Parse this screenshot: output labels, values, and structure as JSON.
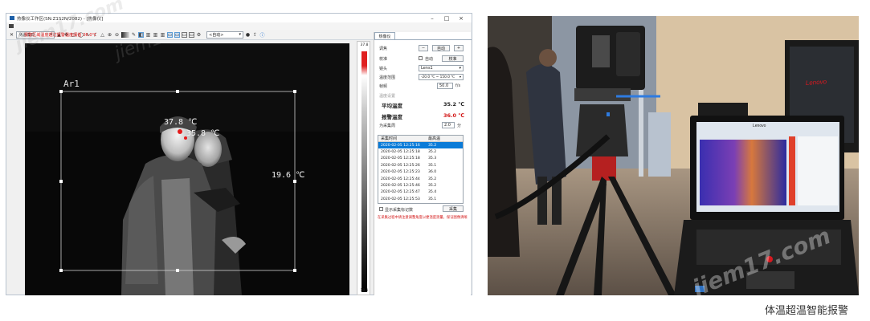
{
  "app": {
    "title": "热像仪工作区(SN:Z1S2N/2082) - [热像仪]",
    "window_buttons": [
      "–",
      "□",
      "×"
    ]
  },
  "toolbar": {
    "mode_select": "测温模式",
    "range_select": "<自动>"
  },
  "alarm_banner": "报警区域温度超过报警温度阈值 36.0℃",
  "thermal": {
    "area_label": "Ar1",
    "reading_1": "37.8 ℃",
    "reading_2": "35.8 ℃",
    "reading_3": "19.6 ℃"
  },
  "scale": {
    "top": "37.8",
    "bottom": "18.1"
  },
  "panel": {
    "tab": "热像仪",
    "focus_label": "调焦",
    "focus_minus": "−",
    "focus_auto": "自动",
    "focus_plus": "+",
    "calib_label": "校准",
    "calib_auto_checkbox": "自动",
    "calib_button": "校准",
    "lens_label": "镜头",
    "lens_value": "Lens1",
    "range_label": "温度范围",
    "range_value": "-20.0 ℃ ~ 150.0 ℃",
    "emis_label": "帧频",
    "emis_value": "50.0",
    "emis_unit": "f/s",
    "section_label": "温度设置",
    "avg_label": "平均温度",
    "avg_value": "35.2 ℃",
    "alarm_label": "报警温度",
    "alarm_value": "36.0 ℃",
    "interval_label": "为采集周",
    "interval_value": "2.0",
    "interval_unit": "分",
    "table_headers": [
      "采集时间",
      "最高温"
    ],
    "table_rows": [
      [
        "2020-02-05 12:25:16",
        "35.2"
      ],
      [
        "2020-02-05 12:25:18",
        "35.2"
      ],
      [
        "2020-02-05 12:25:18",
        "35.3"
      ],
      [
        "2020-02-05 12:25:26",
        "35.1"
      ],
      [
        "2020-02-05 12:25:23",
        "36.0"
      ],
      [
        "2020-02-05 12:25:44",
        "35.2"
      ],
      [
        "2020-02-05 12:25:46",
        "35.2"
      ],
      [
        "2020-02-05 12:25:47",
        "35.4"
      ],
      [
        "2020-02-05 12:25:53",
        "35.1"
      ]
    ],
    "show_record_checkbox": "显示采集标记数",
    "capture_button": "采集",
    "note": "在采集过程中请注意调整角度以便温度测量，保证图像清晰"
  },
  "photo": {
    "laptop_brand": "Lenovo",
    "monitor_brand": "Lenovo"
  },
  "watermark": "jiem17.com",
  "caption": "体温超温智能报警"
}
